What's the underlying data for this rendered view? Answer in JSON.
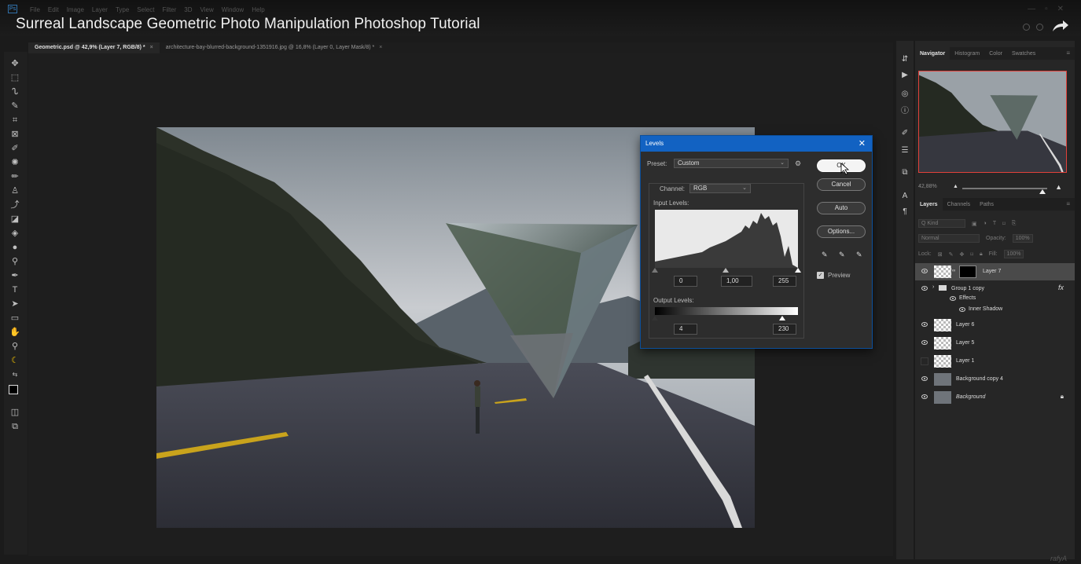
{
  "video": {
    "title": "Surreal Landscape Geometric Photo Manipulation Photoshop Tutorial"
  },
  "app": {
    "logo": "Ps",
    "menu": [
      "File",
      "Edit",
      "Image",
      "Layer",
      "Type",
      "Select",
      "Filter",
      "3D",
      "View",
      "Window",
      "Help"
    ]
  },
  "tabs": [
    {
      "label": "Geometric.psd @ 42,9% (Layer 7, RGB/8) *",
      "close": "×",
      "active": true
    },
    {
      "label": "architecture-bay-blurred-background-1351916.jpg @ 16,8% (Layer 0, Layer Mask/8) *",
      "close": "×",
      "active": false
    }
  ],
  "levels": {
    "title": "Levels",
    "close": "✕",
    "preset_label": "Preset:",
    "preset_value": "Custom",
    "channel_label": "Channel:",
    "channel_value": "RGB",
    "input_levels_label": "Input Levels:",
    "input_black": "0",
    "input_gamma": "1,00",
    "input_white": "255",
    "output_levels_label": "Output Levels:",
    "output_black": "4",
    "output_white": "230",
    "buttons": {
      "ok": "OK",
      "cancel": "Cancel",
      "auto": "Auto",
      "options": "Options..."
    },
    "preview_label": "Preview",
    "preview_checked": true
  },
  "navigator": {
    "tabs": [
      "Navigator",
      "Histogram",
      "Color",
      "Swatches"
    ],
    "zoom": "42,88%"
  },
  "layers_panel": {
    "tabs": [
      "Layers",
      "Channels",
      "Paths"
    ],
    "kind_label": "Q Kind",
    "blend_mode": "Normal",
    "opacity_label": "Opacity:",
    "opacity_value": "100%",
    "lock_label": "Lock:",
    "fill_label": "Fill:",
    "fill_value": "100%",
    "layers": [
      {
        "name": "Layer 7",
        "visible": true,
        "selected": true
      },
      {
        "name": "Group 1 copy",
        "visible": true,
        "fx": "fx"
      },
      {
        "name": "Effects",
        "visible": true
      },
      {
        "name": "Inner Shadow",
        "visible": true
      },
      {
        "name": "Layer 6",
        "visible": true
      },
      {
        "name": "Layer 5",
        "visible": true
      },
      {
        "name": "Layer 1",
        "visible": false
      },
      {
        "name": "Background copy 4",
        "visible": true
      },
      {
        "name": "Background",
        "visible": true
      }
    ]
  },
  "watermark": "rafyA",
  "colors": {
    "accent": "#1262c2",
    "navigator_frame": "#e2413a",
    "selected_layer": "#4a4a4a"
  }
}
